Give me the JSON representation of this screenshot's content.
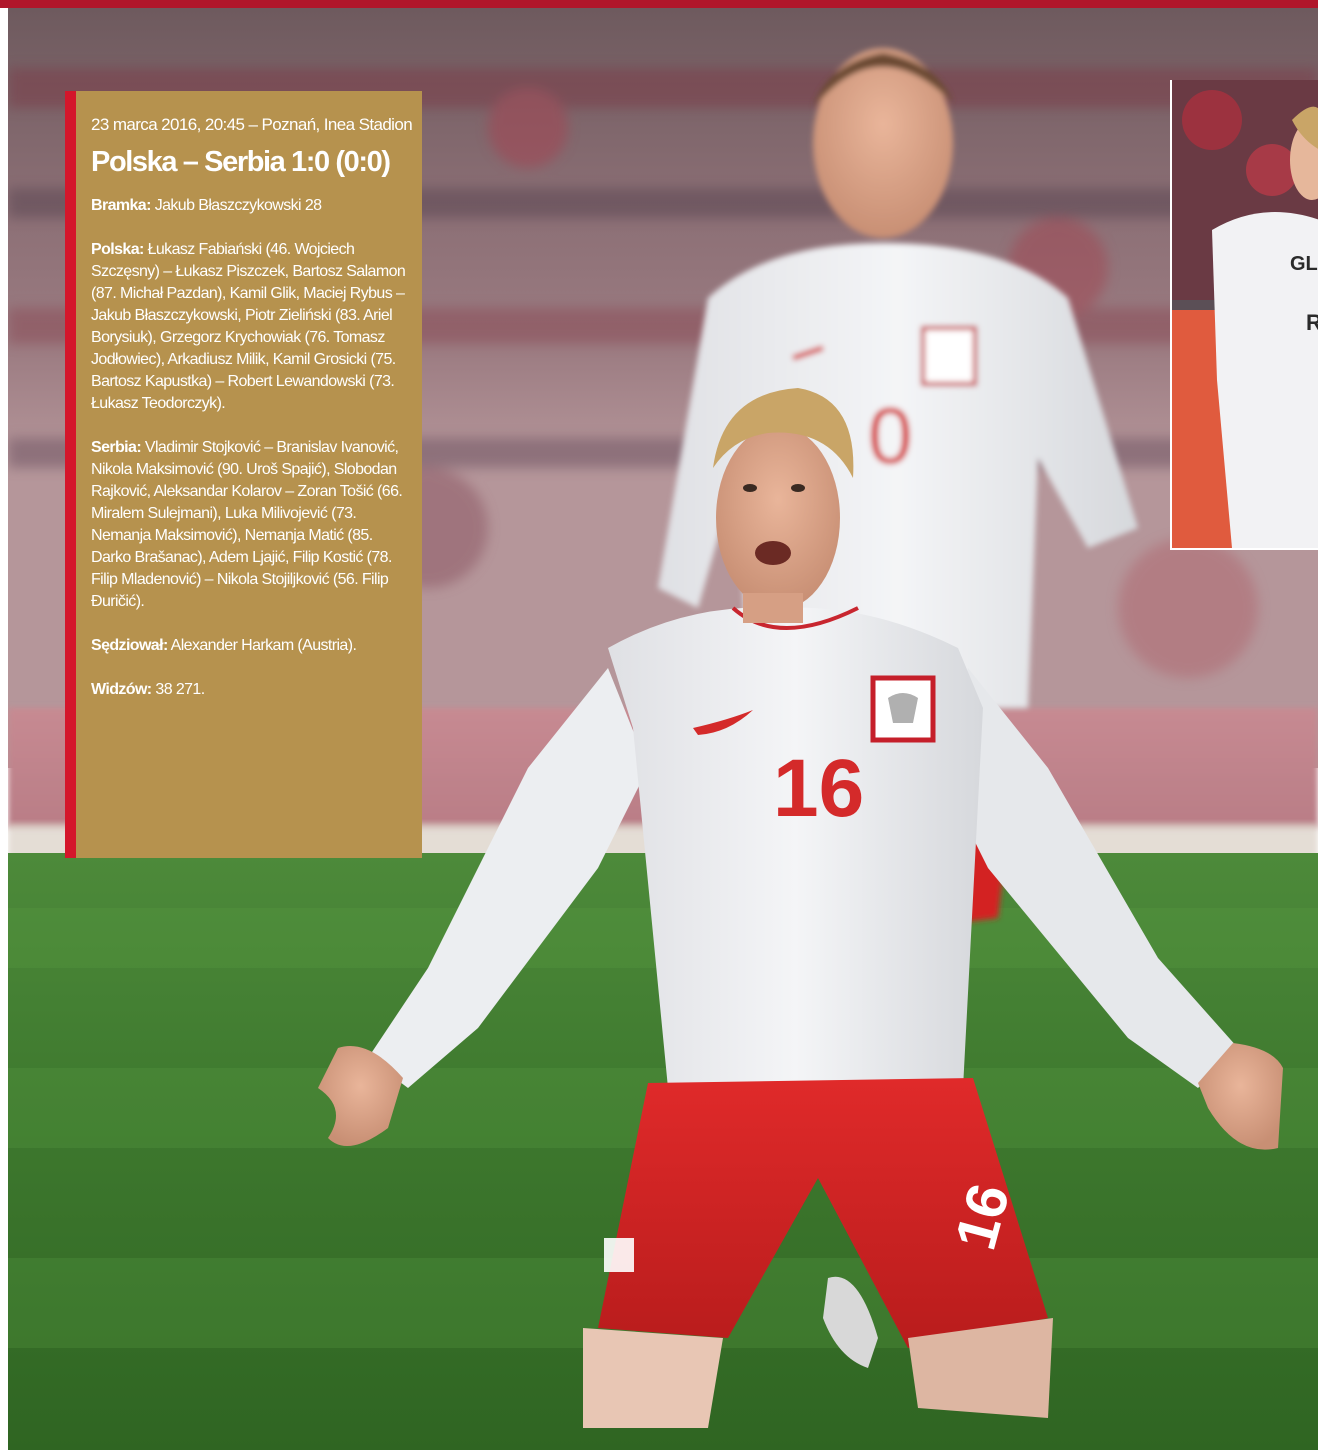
{
  "match": {
    "date_venue": "23 marca 2016, 20:45 – Poznań, Inea Stadion",
    "title": "Polska – Serbia 1:0 (0:0)"
  },
  "goals": {
    "label": "Bramka:",
    "text": "Jakub Błaszczykowski 28"
  },
  "poland": {
    "label": "Polska:",
    "text": "Łukasz Fabiański (46. Wojciech Szczęsny) – Łukasz Piszczek, Bartosz Salamon (87. Michał Pazdan), Kamil Glik, Maciej Rybus – Jakub Błaszczykowski, Piotr Zieliński (83. Ariel Borysiuk), Grzegorz Krychowiak (76. Tomasz Jodłowiec), Arkadiusz Milik, Kamil Grosicki (75. Bartosz Kapustka) – Robert Lewandowski (73. Łukasz Teodorczyk)."
  },
  "serbia": {
    "label": "Serbia:",
    "text": "Vladimir Stojković – Branislav Ivanović, Nikola Maksimović (90. Uroš Spajić), Slobodan Rajković, Aleksandar Kolarov – Zoran Tošić (66. Miralem Sulejmani), Luka Milivojević (73. Nemanja Maksimović), Nemanja Matić (85. Darko Brašanac), Adem Ljajić, Filip Kostić (78. Filip Mladenović) – Nikola Stojiljković (56. Filip Đuričić)."
  },
  "referee": {
    "label": "Sędziował:",
    "text": "Alexander Harkam (Austria)."
  },
  "attendance": {
    "label": "Widzów:",
    "text": "38 271."
  },
  "photo": {
    "jersey_number_front": "16",
    "jersey_number_shorts": "16",
    "jersey_number_back": "0",
    "inset_letters_1": "GL",
    "inset_letters_2": "R"
  },
  "colors": {
    "accent_red": "#d4162b",
    "box_gold": "#b6924e",
    "rule_red": "#b0162a"
  }
}
